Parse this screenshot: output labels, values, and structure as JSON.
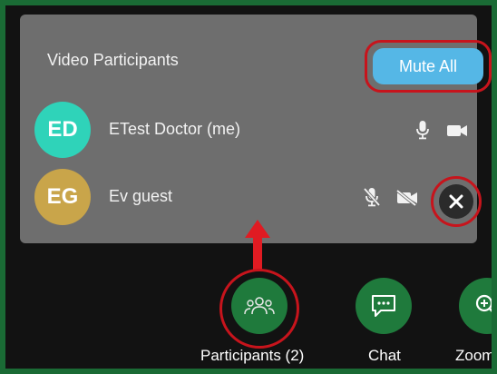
{
  "panel": {
    "title": "Video Participants",
    "mute_all_label": "Mute All"
  },
  "participants": [
    {
      "initials": "ED",
      "name": "ETest Doctor (me)",
      "avatar_color": "#2fd3b9",
      "mic": "on",
      "camera": "on"
    },
    {
      "initials": "EG",
      "name": "Ev guest",
      "avatar_color": "#c9a54a",
      "mic": "off",
      "camera": "off"
    }
  ],
  "toolbar": {
    "participants_label": "Participants (2)",
    "chat_label": "Chat",
    "zoom_label": "Zoom"
  },
  "colors": {
    "panel_bg": "#6e6e6e",
    "mute_all_button": "#55b7e6",
    "toolbar_button": "#1f7a3c",
    "highlight_annotation": "#c7141c",
    "frame_border": "#1a6b35"
  },
  "icons": {
    "mic_on": "microphone-icon",
    "mic_off": "microphone-off-icon",
    "cam_on": "video-camera-icon",
    "cam_off": "video-camera-off-icon",
    "remove": "close-icon",
    "participants": "people-group-icon",
    "chat": "chat-bubble-icon",
    "zoom": "zoom-in-icon",
    "annotation_arrow": "arrow-up-icon"
  }
}
